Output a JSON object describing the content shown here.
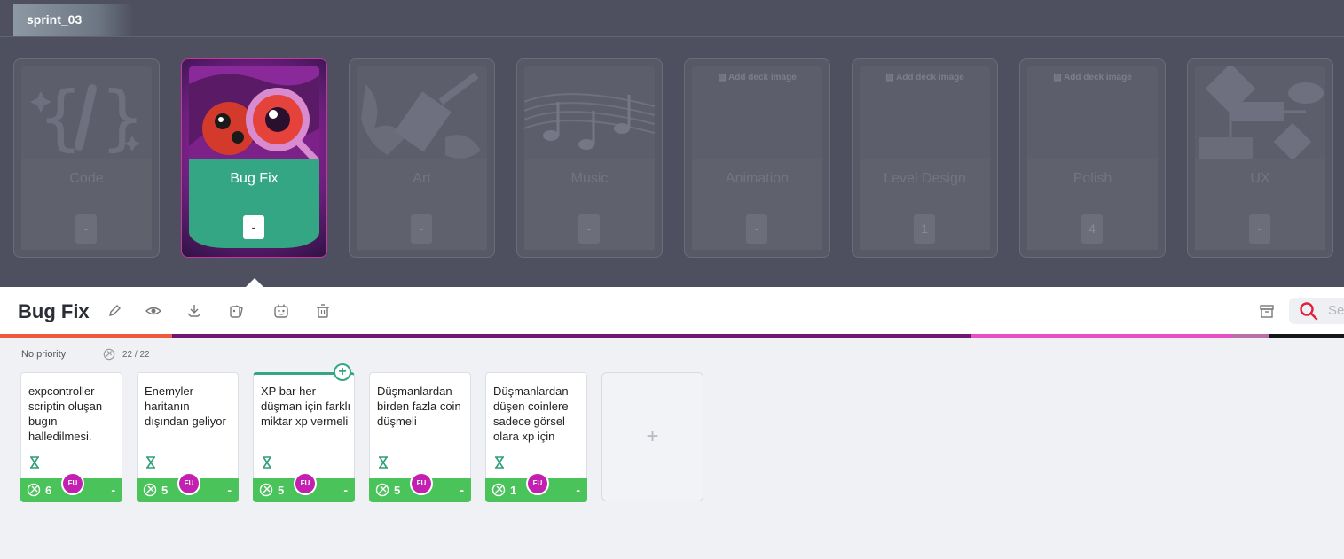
{
  "sprint_tab": {
    "label": "sprint_03"
  },
  "decks": [
    {
      "label": "Code",
      "count": "-",
      "image": "code-braces-art"
    },
    {
      "label": "Bug Fix",
      "count": "-",
      "image": "ladybug-magnifier-art"
    },
    {
      "label": "Art",
      "count": "-",
      "image": "paint-brush-art"
    },
    {
      "label": "Music",
      "count": "-",
      "image": "music-notes-art"
    },
    {
      "label": "Animation",
      "count": "-",
      "add_image": "Add deck image"
    },
    {
      "label": "Level Design",
      "count": "1",
      "add_image": "Add deck image"
    },
    {
      "label": "Polish",
      "count": "4",
      "add_image": "Add deck image"
    },
    {
      "label": "UX",
      "count": "-",
      "image": "flowchart-art"
    }
  ],
  "titlebar": {
    "title": "Bug Fix",
    "icons": [
      "pencil-icon",
      "eye-icon",
      "download-icon",
      "palette-icon",
      "robot-icon",
      "trash-icon"
    ],
    "archive_icon": "archive-icon",
    "search_placeholder": "Search"
  },
  "color_strip": [
    "#ef5a3c",
    "#6e1671",
    "#e84fc2",
    "#b86ea6",
    "#161616"
  ],
  "list": {
    "priority_label": "No priority",
    "progress": "22 / 22"
  },
  "cards": [
    {
      "text": "expcontroller scriptin oluşan bugın halledilmesi.",
      "points": "6",
      "avatar": "FU",
      "dash": "-"
    },
    {
      "text": "Enemyler haritanın dışından geliyor",
      "points": "5",
      "avatar": "FU",
      "dash": "-"
    },
    {
      "text": "XP bar her düşman için farklı miktar xp vermeli",
      "points": "5",
      "avatar": "FU",
      "dash": "-"
    },
    {
      "text": "Düşmanlardan birden fazla coin düşmeli",
      "points": "5",
      "avatar": "FU",
      "dash": "-"
    },
    {
      "text": "Düşmanlardan düşen coinlere sadece görsel olara xp için",
      "points": "1",
      "avatar": "FU",
      "dash": "-"
    }
  ],
  "add_card": {
    "label": "+"
  },
  "plus_badge": "+",
  "colors": {
    "accent_green": "#35a683",
    "footer_green": "#49c35a",
    "avatar_magenta": "#c31fb0",
    "search_red": "#e0213b"
  }
}
